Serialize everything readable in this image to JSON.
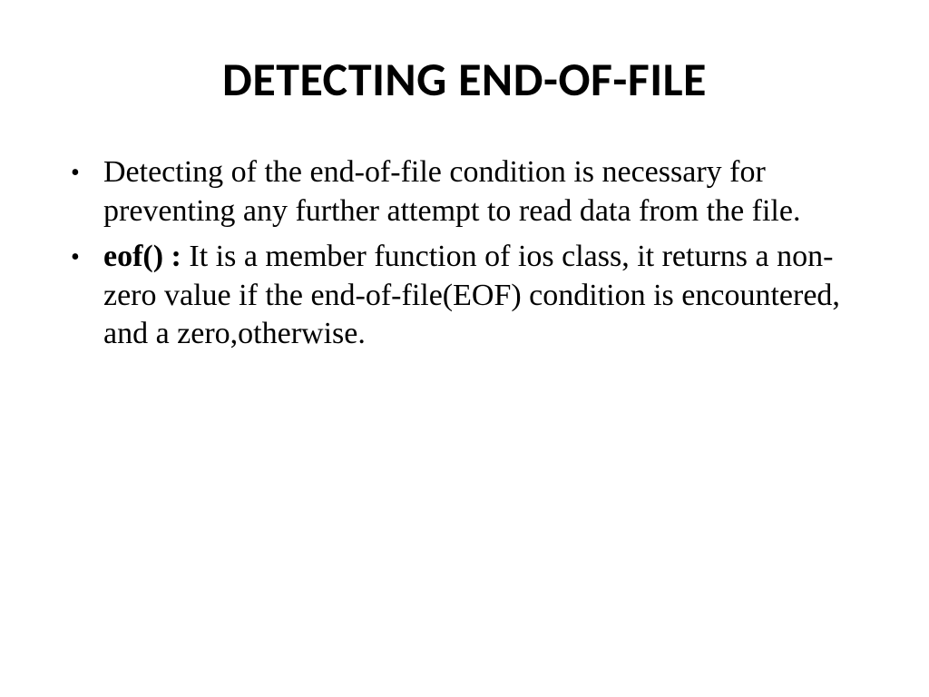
{
  "slide": {
    "title": "DETECTING END-OF-FILE",
    "bullets": [
      {
        "text": "Detecting of the end-of-file condition is necessary for preventing any further attempt to read data from the file."
      },
      {
        "label": "eof() :",
        "text": "  It is a member function of ios class, it returns a non-zero value if the end-of-file(EOF) condition is encountered, and a  zero,otherwise."
      }
    ]
  }
}
